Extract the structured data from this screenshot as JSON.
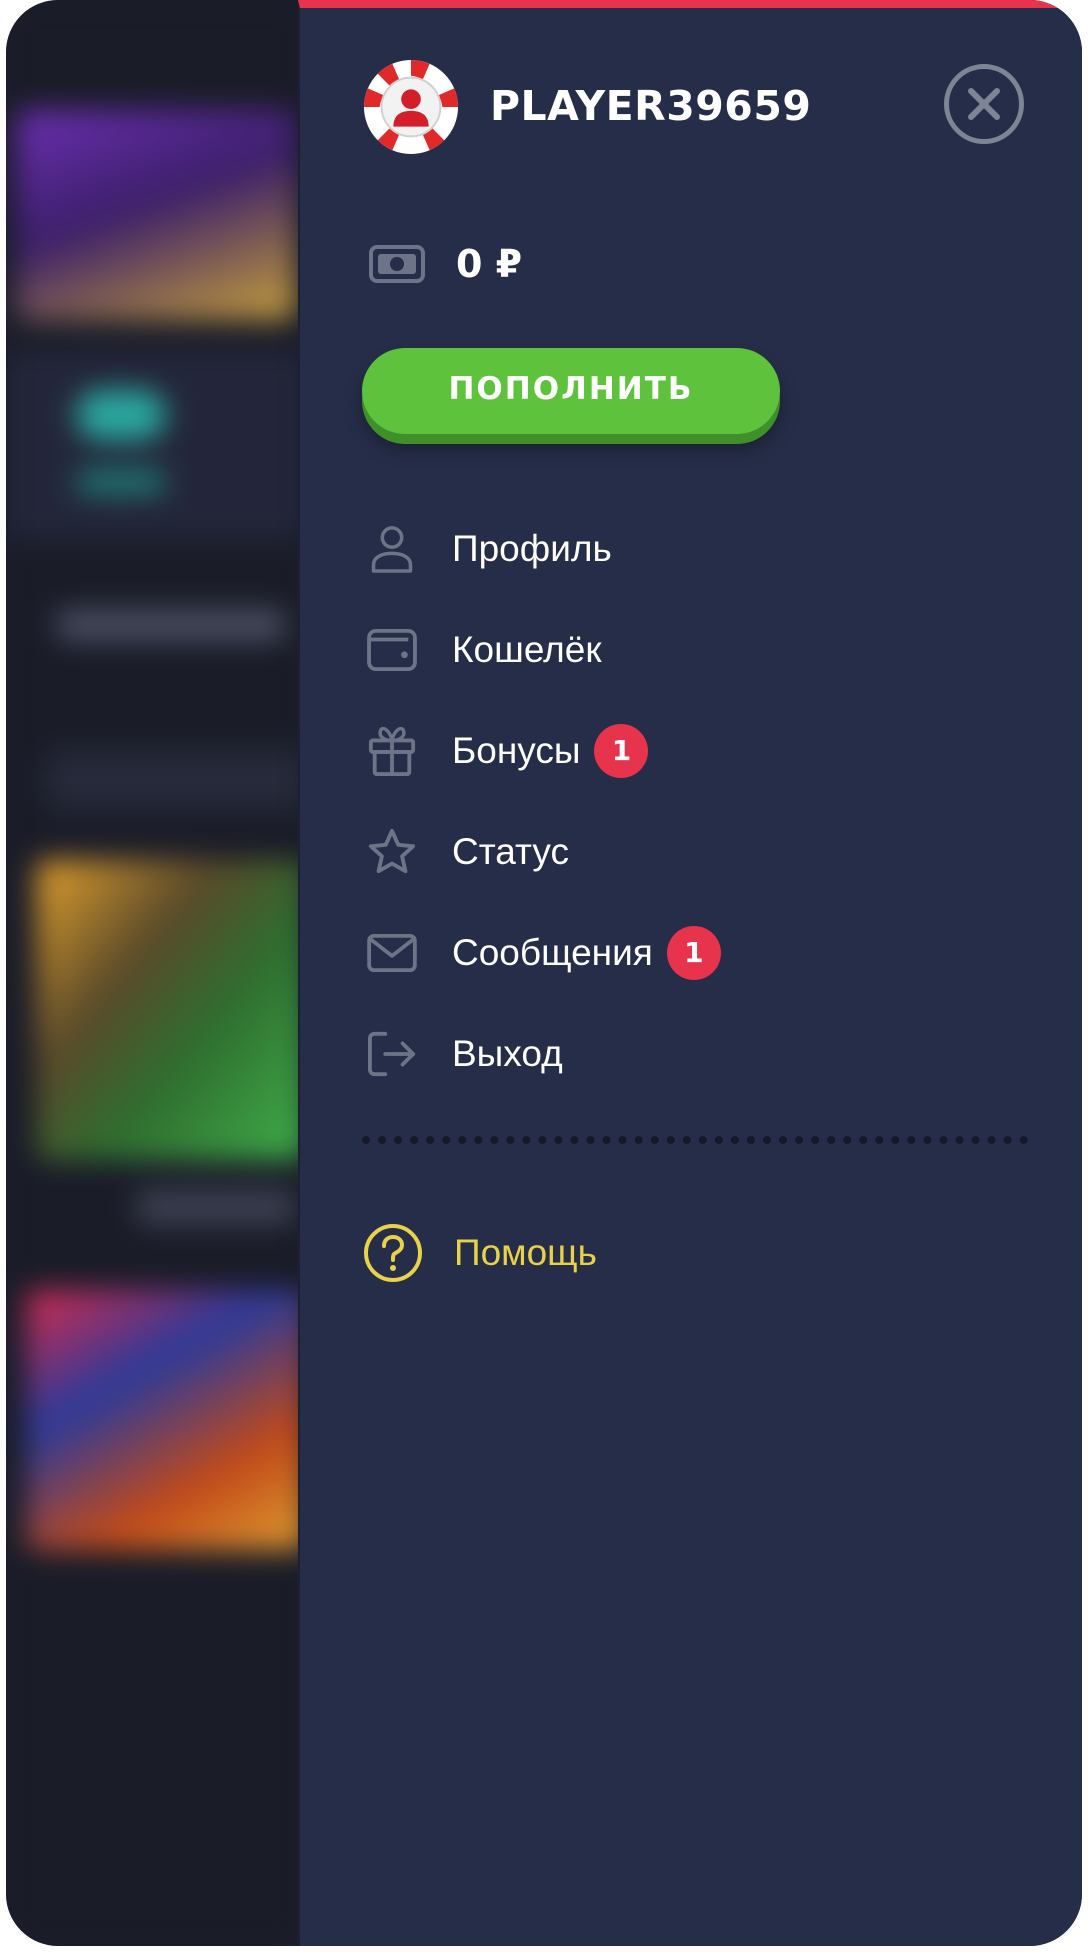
{
  "user": {
    "name": "PLAYER39659"
  },
  "balance": {
    "amount": "0 ₽"
  },
  "deposit_button": {
    "label": "ПОПОЛНИТЬ"
  },
  "menu": {
    "items": [
      {
        "id": "profile",
        "label": "Профиль",
        "icon": "user-icon"
      },
      {
        "id": "wallet",
        "label": "Кошелёк",
        "icon": "wallet-icon"
      },
      {
        "id": "bonuses",
        "label": "Бонусы",
        "icon": "gift-icon",
        "badge": "1"
      },
      {
        "id": "status",
        "label": "Статус",
        "icon": "star-icon"
      },
      {
        "id": "messages",
        "label": "Сообщения",
        "icon": "envelope-icon",
        "badge": "1"
      },
      {
        "id": "logout",
        "label": "Выход",
        "icon": "logout-icon"
      }
    ]
  },
  "help": {
    "label": "Помощь"
  },
  "colors": {
    "accent_red": "#e8334c",
    "deposit_green": "#5ec23d",
    "drawer_bg": "#262d48",
    "help_yellow": "#e9d24a",
    "icon_gray": "#6d7488"
  }
}
